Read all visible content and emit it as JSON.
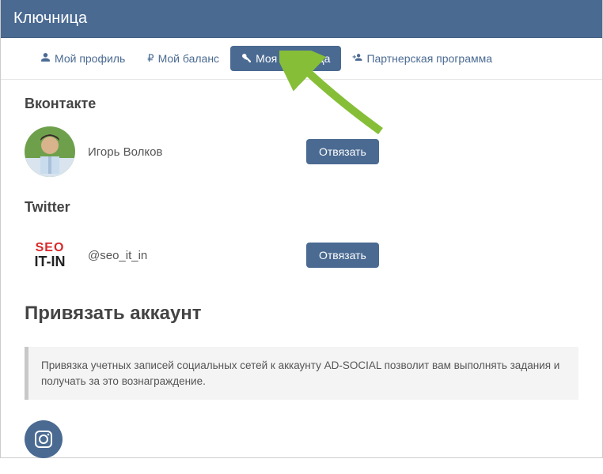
{
  "header": {
    "title": "Ключница"
  },
  "tabs": {
    "profile": "Мой профиль",
    "balance": "Мой баланс",
    "keystore": "Моя ключница",
    "partner": "Партнерская программа"
  },
  "sections": {
    "vk": {
      "title": "Вконтакте",
      "account_name": "Игорь Волков",
      "unlink_label": "Отвязать"
    },
    "twitter": {
      "title": "Twitter",
      "account_name": "@seo_it_in",
      "logo_top": "SEO",
      "logo_bottom": "IT-IN",
      "unlink_label": "Отвязать"
    }
  },
  "link_section": {
    "title": "Привязать аккаунт",
    "info": "Привязка учетных записей социальных сетей к аккаунту AD-SOCIAL позволит вам выполнять задания и получать за это вознаграждение."
  },
  "colors": {
    "primary": "#4a6a92",
    "accent_green": "#86bf37"
  }
}
